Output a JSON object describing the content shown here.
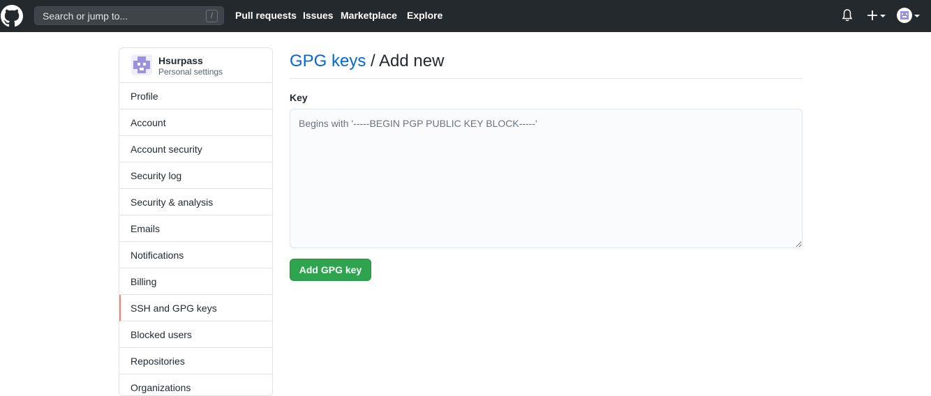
{
  "header": {
    "search_placeholder": "Search or jump to...",
    "slash_key": "/",
    "nav": [
      "Pull requests",
      "Issues",
      "Marketplace",
      "Explore"
    ]
  },
  "sidebar": {
    "username": "Hsurpass",
    "subtitle": "Personal settings",
    "items": [
      {
        "label": "Profile"
      },
      {
        "label": "Account"
      },
      {
        "label": "Account security"
      },
      {
        "label": "Security log"
      },
      {
        "label": "Security & analysis"
      },
      {
        "label": "Emails"
      },
      {
        "label": "Notifications"
      },
      {
        "label": "Billing"
      },
      {
        "label": "SSH and GPG keys",
        "active": true
      },
      {
        "label": "Blocked users"
      },
      {
        "label": "Repositories"
      },
      {
        "label": "Organizations"
      }
    ]
  },
  "main": {
    "breadcrumb_link": "GPG keys",
    "breadcrumb_sep": "/",
    "breadcrumb_current": "Add new",
    "key_label": "Key",
    "key_placeholder": "Begins with '-----BEGIN PGP PUBLIC KEY BLOCK-----'",
    "submit_label": "Add GPG key"
  },
  "colors": {
    "header_bg": "#24292e",
    "link": "#0366d6",
    "primary_button": "#2ea44f",
    "active_marker": "#f9826c"
  }
}
